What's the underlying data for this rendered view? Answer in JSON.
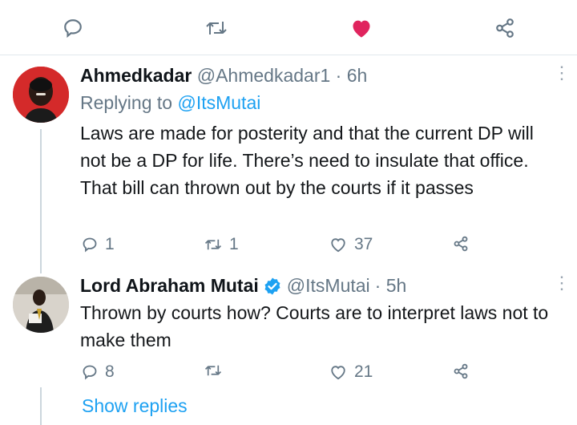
{
  "top_actions": {
    "liked": true
  },
  "colors": {
    "accent": "#1da1f2",
    "like": "#e0245e",
    "secondary": "#657786",
    "divider": "#e1e8ed"
  },
  "tweets": [
    {
      "name": "Ahmedkadar",
      "handle": "@Ahmedkadar1",
      "time": "· 6h",
      "replying_prefix": "Replying to ",
      "replying_to": "@ItsMutai",
      "text": "Laws are made for posterity and that the current DP will not be a DP for life. There’s need to insulate that office. That bill can thrown out by the courts if it passes",
      "reply_count": "1",
      "retweet_count": "1",
      "like_count": "37",
      "avatar_icon": "person-red-background"
    },
    {
      "name": "Lord Abraham Mutai",
      "verified": true,
      "handle": "@ItsMutai",
      "time": "· 5h",
      "text": "Thrown by courts how? Courts are to interpret laws not to make them",
      "reply_count": "8",
      "retweet_count": "",
      "like_count": "21",
      "avatar_icon": "person-photo"
    }
  ],
  "show_replies": "Show replies"
}
